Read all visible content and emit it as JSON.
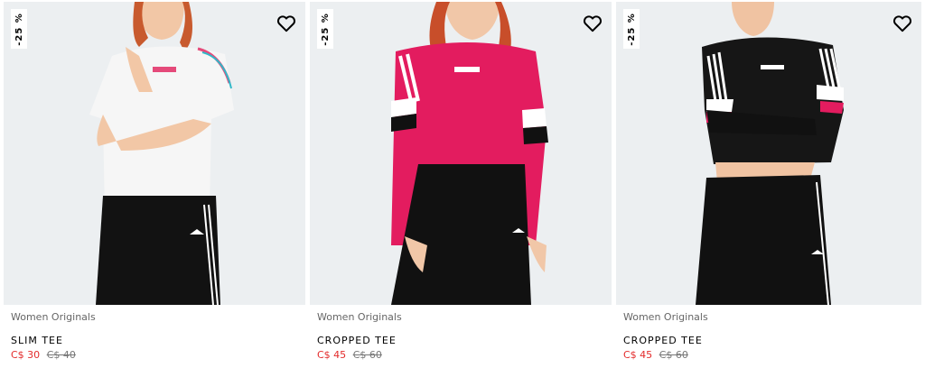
{
  "products": [
    {
      "badge": "-25 %",
      "category": "Women Originals",
      "name": "SLIM TEE",
      "sale_price": "C$ 30",
      "original_price": "C$ 40",
      "shirt_color": "#f6f6f6",
      "trim_color": "#e54a7a"
    },
    {
      "badge": "-25 %",
      "category": "Women Originals",
      "name": "CROPPED TEE",
      "sale_price": "C$ 45",
      "original_price": "C$ 60",
      "shirt_color": "#e31c5f",
      "trim_color": "#ffffff"
    },
    {
      "badge": "-25 %",
      "category": "Women Originals",
      "name": "CROPPED TEE",
      "sale_price": "C$ 45",
      "original_price": "C$ 60",
      "shirt_color": "#161616",
      "trim_color": "#ffffff"
    }
  ],
  "icons": {
    "wishlist": "heart-outline-icon"
  },
  "colors": {
    "sale": "#e32b2b",
    "image_bg": "#eceff1"
  }
}
